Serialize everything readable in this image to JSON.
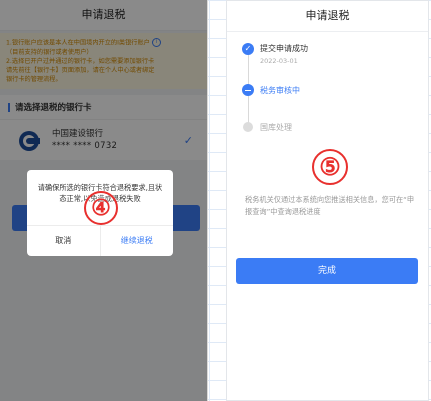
{
  "left": {
    "title": "申请退税",
    "notice": {
      "line1": "1.银行账户应该是本人在中国境内开立的I类银行账户",
      "line2": "（目前支持的银行或者使用户）",
      "line3": "2.选择已开户过并通过的银行卡，如您需要添加银行卡",
      "line4": "请先前往【银行卡】页面添加，请在个人中心或者绑定",
      "line5": "银行卡的管理流程。"
    },
    "section_title": "请选择退税的银行卡",
    "bank": {
      "name": "中国建设银行",
      "card": "**** **** 0732"
    },
    "dialog": {
      "message": "请确保所选的银行卡符合退税要求,且状态正常,以免造成退税失败",
      "cancel": "取消",
      "continue": "继续退税"
    },
    "marker": "④"
  },
  "right": {
    "title": "申请退税",
    "steps": [
      {
        "label": "提交申请成功",
        "date": "2022-03-01"
      },
      {
        "label": "税务审核中"
      },
      {
        "label": "国库处理"
      }
    ],
    "marker": "⑤",
    "info": "税务机关仅通过本系统向您推送相关信息，您可在“申报查询”中查询退税进度",
    "done": "完成"
  },
  "colors": {
    "accent": "#3b7cf5",
    "marker": "#e8302e",
    "notice_text": "#d28a00"
  },
  "icons": {
    "info": "info-circle-icon",
    "check": "check-icon",
    "bank_logo": "ccb-logo-icon"
  }
}
